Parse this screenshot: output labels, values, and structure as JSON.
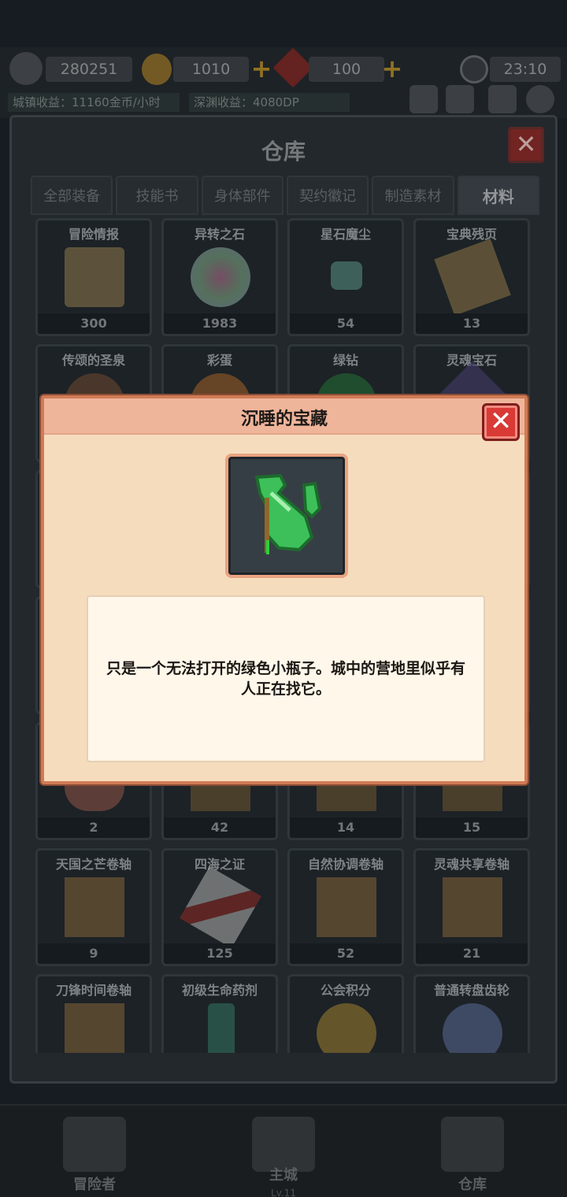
{
  "status_bar": {
    "power": "280251",
    "gold": "1010",
    "gems": "100",
    "time": "23:10",
    "town_income": "城镇收益：11160金币/小时",
    "abyss_income": "深渊收益：4080DP"
  },
  "warehouse": {
    "title": "仓库",
    "tabs": [
      "全部装备",
      "技能书",
      "身体部件",
      "契约徽记",
      "制造素材",
      "材料"
    ],
    "active_tab": "材料",
    "items": [
      {
        "name": "冒险情报",
        "count": "300"
      },
      {
        "name": "异转之石",
        "count": "1983"
      },
      {
        "name": "星石魔尘",
        "count": "54"
      },
      {
        "name": "宝典残页",
        "count": "13"
      },
      {
        "name": "传颂的圣泉",
        "count": ""
      },
      {
        "name": "彩蛋",
        "count": ""
      },
      {
        "name": "绿钻",
        "count": ""
      },
      {
        "name": "灵魂宝石",
        "count": ""
      },
      {
        "name": "",
        "count": "2"
      },
      {
        "name": "",
        "count": "42"
      },
      {
        "name": "",
        "count": "14"
      },
      {
        "name": "",
        "count": "15"
      },
      {
        "name": "天国之芒卷轴",
        "count": "9"
      },
      {
        "name": "四海之证",
        "count": "125"
      },
      {
        "name": "自然协调卷轴",
        "count": "52"
      },
      {
        "name": "灵魂共享卷轴",
        "count": "21"
      },
      {
        "name": "刀锋时间卷轴",
        "count": ""
      },
      {
        "name": "初级生命药剂",
        "count": ""
      },
      {
        "name": "公会积分",
        "count": ""
      },
      {
        "name": "普通转盘齿轮",
        "count": ""
      }
    ]
  },
  "modal": {
    "title": "沉睡的宝藏",
    "description": "只是一个无法打开的绿色小瓶子。城中的营地里似乎有人正在找它。"
  },
  "bottom_nav": {
    "adventurer": "冒险者",
    "main_city": "主城",
    "main_city_level": "Lv.11",
    "warehouse": "仓库"
  },
  "colors": {
    "modal_bg": "#f5dcbd",
    "modal_header": "#efb59b",
    "close_red": "#d93a35",
    "accent_gold": "#b08a2a"
  }
}
